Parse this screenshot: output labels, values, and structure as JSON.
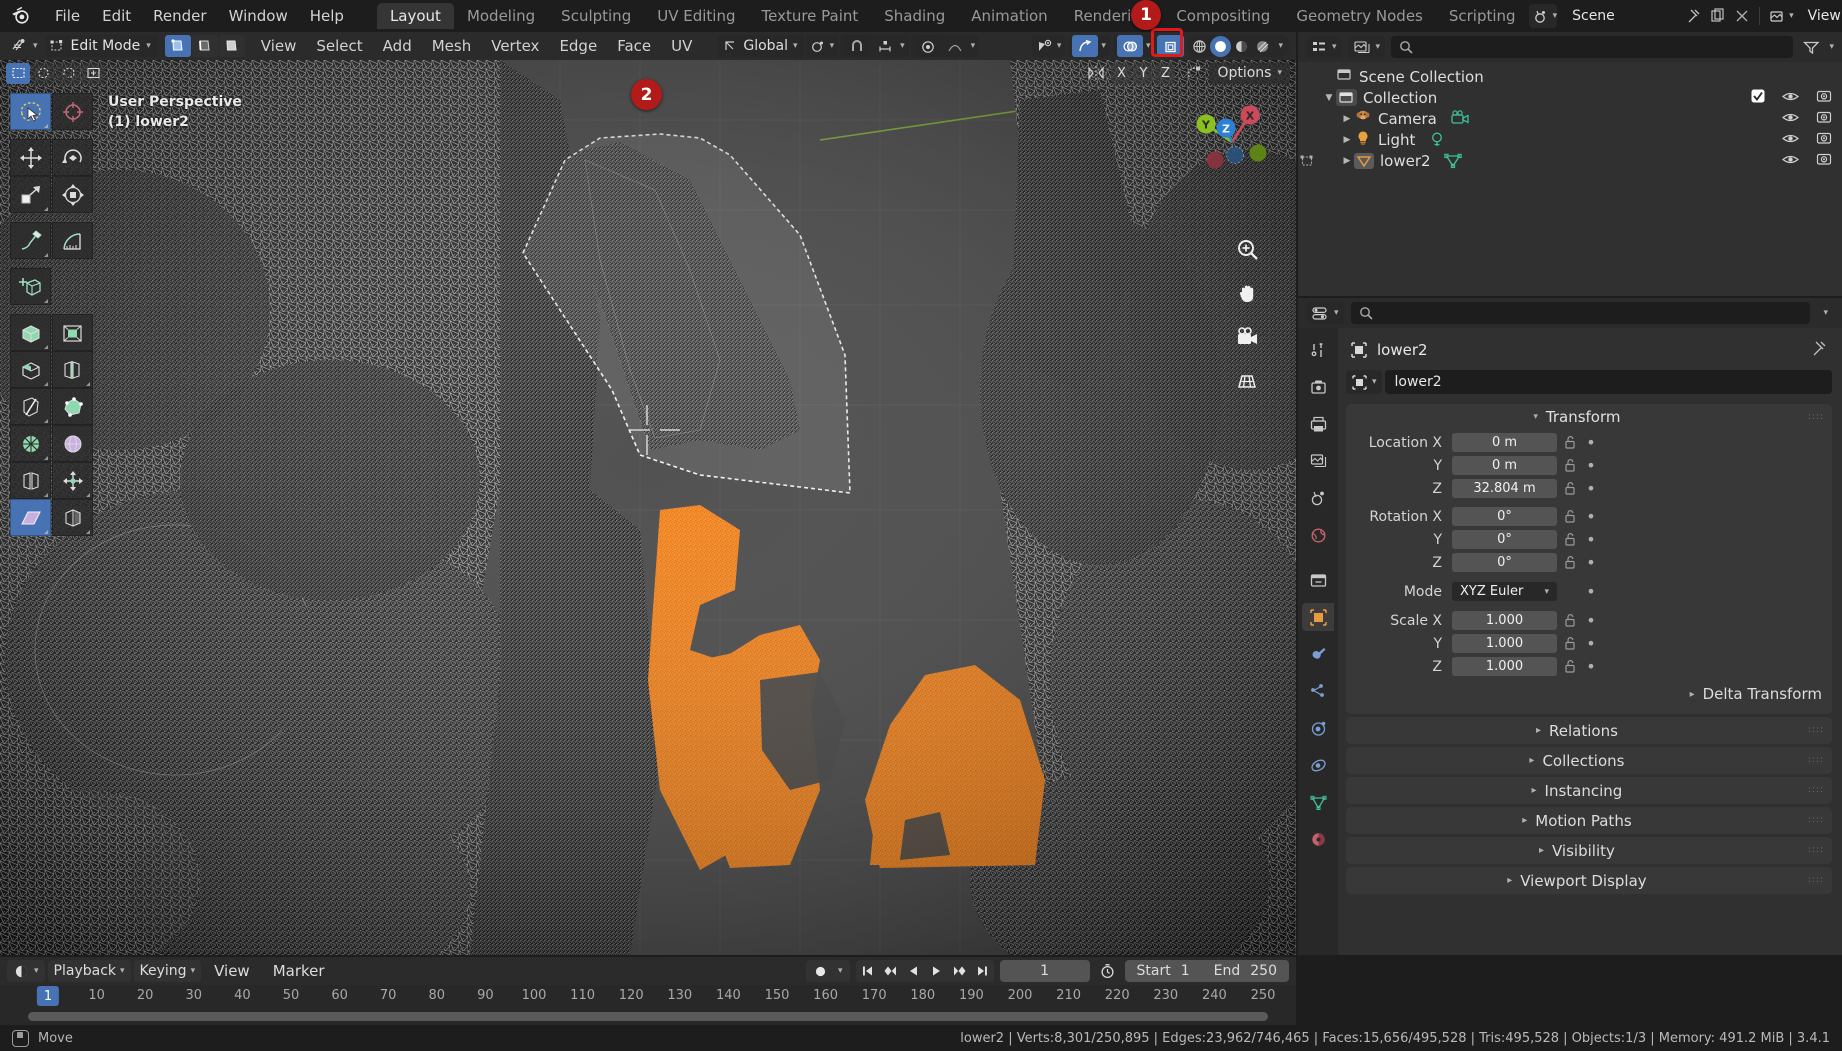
{
  "topbar": {
    "menus": [
      "File",
      "Edit",
      "Render",
      "Window",
      "Help"
    ],
    "workspaces": [
      {
        "label": "Layout",
        "active": true
      },
      {
        "label": "Modeling",
        "active": false
      },
      {
        "label": "Sculpting",
        "active": false
      },
      {
        "label": "UV Editing",
        "active": false
      },
      {
        "label": "Texture Paint",
        "active": false
      },
      {
        "label": "Shading",
        "active": false
      },
      {
        "label": "Animation",
        "active": false
      },
      {
        "label": "Rendering",
        "active": false
      },
      {
        "label": "Compositing",
        "active": false
      },
      {
        "label": "Geometry Nodes",
        "active": false
      },
      {
        "label": "Scripting",
        "active": false
      }
    ],
    "scene_name": "Scene",
    "viewlayer_name": "ViewLayer"
  },
  "viewport_header": {
    "mode": "Edit Mode",
    "menus": [
      "View",
      "Select",
      "Add",
      "Mesh",
      "Vertex",
      "Edge",
      "Face",
      "UV"
    ],
    "orientation": "Global",
    "options_label": "Options",
    "axis_buttons": [
      "X",
      "Y",
      "Z"
    ]
  },
  "viewport": {
    "perspective_label": "User Perspective",
    "object_label": "(1) lower2",
    "gizmo_axes": {
      "x": "X",
      "y": "Y",
      "z": "Z"
    }
  },
  "annotations": [
    {
      "number": "1",
      "target": "xray-toggle-button"
    },
    {
      "number": "2",
      "target": "lasso-selection-region"
    }
  ],
  "outliner": {
    "rows": [
      {
        "name": "Scene Collection",
        "depth": 0,
        "icon": "collection-icon",
        "disclosure": "",
        "has_checkbox": false,
        "has_visibility": false
      },
      {
        "name": "Collection",
        "depth": 1,
        "icon": "collection-icon",
        "disclosure": "down",
        "has_checkbox": true,
        "has_visibility": true
      },
      {
        "name": "Camera",
        "depth": 2,
        "icon": "camera-object-icon",
        "disclosure": "right",
        "has_checkbox": false,
        "has_visibility": true,
        "data_icon": "camera-data-icon"
      },
      {
        "name": "Light",
        "depth": 2,
        "icon": "light-object-icon",
        "disclosure": "right",
        "has_checkbox": false,
        "has_visibility": true,
        "data_icon": "light-data-icon"
      },
      {
        "name": "lower2",
        "depth": 2,
        "icon": "mesh-object-icon",
        "disclosure": "right",
        "has_checkbox": false,
        "has_visibility": true,
        "data_icon": "mesh-data-icon",
        "selected": true
      }
    ]
  },
  "properties": {
    "breadcrumb_object": "lower2",
    "object_name_field": "lower2",
    "transform": {
      "title": "Transform",
      "rows": [
        {
          "label": "Location X",
          "value": "0 m"
        },
        {
          "label": "Y",
          "value": "0 m"
        },
        {
          "label": "Z",
          "value": "32.804 m"
        },
        {
          "label": "Rotation X",
          "value": "0°"
        },
        {
          "label": "Y",
          "value": "0°"
        },
        {
          "label": "Z",
          "value": "0°"
        }
      ],
      "mode_label": "Mode",
      "mode_value": "XYZ Euler",
      "scale_rows": [
        {
          "label": "Scale X",
          "value": "1.000"
        },
        {
          "label": "Y",
          "value": "1.000"
        },
        {
          "label": "Z",
          "value": "1.000"
        }
      ],
      "delta_transform": "Delta Transform"
    },
    "collapsed_panels": [
      "Relations",
      "Collections",
      "Instancing",
      "Motion Paths",
      "Visibility",
      "Viewport Display"
    ]
  },
  "timeline": {
    "menus": [
      "Playback",
      "Keying",
      "View",
      "Marker"
    ],
    "current_frame": "1",
    "start_label": "Start",
    "start_value": "1",
    "end_label": "End",
    "end_value": "250",
    "ticks": [
      "10",
      "20",
      "30",
      "40",
      "50",
      "60",
      "70",
      "80",
      "90",
      "100",
      "110",
      "120",
      "130",
      "140",
      "150",
      "160",
      "170",
      "180",
      "190",
      "200",
      "210",
      "220",
      "230",
      "240",
      "250"
    ],
    "cursor_frame": "1"
  },
  "statusbar": {
    "left_label": "Move",
    "info": "lower2 | Verts:8,301/250,895 | Edges:23,962/746,465 | Faces:15,656/495,528 | Tris:495,528 | Objects:1/3 | Memory: 491.2 MiB | 3.4.1"
  },
  "colors": {
    "accent_blue": "#4772b3",
    "marker_red": "#b31b1b",
    "selection_orange": "#ff8311",
    "axis_x": "#cc4a5a",
    "axis_y": "#8ac11f",
    "axis_z": "#2b7fd4"
  }
}
